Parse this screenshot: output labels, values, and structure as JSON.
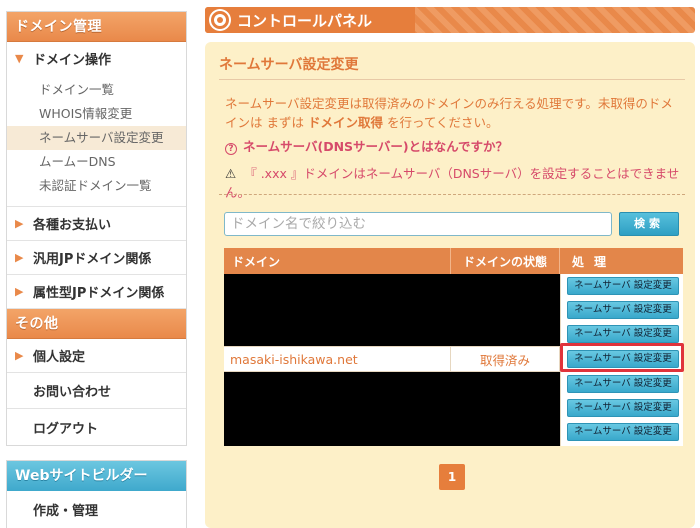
{
  "sidebar": {
    "domain_header": "ドメイン管理",
    "domain_ops": "ドメイン操作",
    "sub_items": [
      "ドメイン一覧",
      "WHOIS情報変更",
      "ネームサーバ設定変更",
      "ムームーDNS",
      "未認証ドメイン一覧"
    ],
    "payments": "各種お支払い",
    "jp_general": "汎用JPドメイン関係",
    "jp_attr": "属性型JPドメイン関係",
    "other_header": "その他",
    "personal": "個人設定",
    "contact": "お問い合わせ",
    "logout": "ログアウト",
    "builder_header": "Webサイトビルダー",
    "builder_item": "作成・管理"
  },
  "panel": {
    "title": "コントロールパネル",
    "section_title": "ネームサーバ設定変更",
    "desc_line1": "ネームサーバ設定変更は取得済みのドメインのみ行える処理です。未取得のドメ",
    "desc_line2_a": "インは まずは ",
    "desc_line2_b": "ドメイン取得",
    "desc_line2_c": " を行ってください。",
    "help_link": "ネームサーバ(DNSサーバー)とはなんですか？",
    "warning": "『 .xxx 』ドメインはネームサーバ（DNSサーバ）を設定することはできません。",
    "filter_placeholder": "ドメイン名で絞り込む",
    "search_label": "検索"
  },
  "table": {
    "headers": {
      "domain": "ドメイン",
      "status": "ドメインの状態",
      "action": "処理"
    },
    "button_label": "ネームサーバ 設定変更",
    "visible_row": {
      "domain": "masaki-ishikawa.net",
      "status": "取得済み"
    }
  },
  "pager": {
    "current": "1"
  },
  "colors": {
    "accent": "#e67e3c",
    "link_red": "#d64a6a",
    "button_blue": "#39a8cb",
    "highlight": "#e0333b"
  }
}
